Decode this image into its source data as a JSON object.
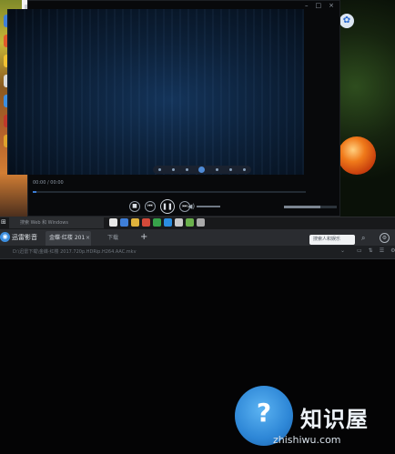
{
  "desktop": {
    "icons": [
      "app-icon",
      "app-icon",
      "app-icon",
      "app-icon",
      "app-icon",
      "app-icon",
      "app-icon",
      "app-icon"
    ]
  },
  "player": {
    "titlebar_buttons": [
      "–",
      "□",
      "×"
    ],
    "time": "00:00 / 00:00",
    "controls": {
      "stop": "■",
      "prev": "⏮",
      "pause": "❚❚",
      "next": "⏭"
    },
    "volume_icon": "◀)",
    "colors": {
      "accent": "#3a7bd5",
      "video_bg": "#0c2038"
    }
  },
  "taskbar": {
    "start": "⊞",
    "search_placeholder": "搜索 Web 和 Windows",
    "apps": [
      "#e7e7e7",
      "#3f7fd8",
      "#e0b23c",
      "#d44a3a",
      "#37a34a",
      "#2b8de0",
      "#c9c9c9",
      "#6ab04c",
      "#a9a9a9"
    ]
  },
  "browser": {
    "name": "迅雷影音",
    "active_tab": "金蝶·红楼 201",
    "tab_close": "×",
    "second_tab": "下载",
    "new_tab": "+",
    "search_placeholder": "搜索人和娱乐",
    "address": "D:\\迅雷下载\\金蝶·红楼 2017.720p.HDRip.H264.AAC.mkv",
    "address_icons": [
      "▭",
      "⇅",
      "☰",
      "⚙"
    ]
  },
  "watermark": {
    "badge_glyph": "?",
    "text": "知识屋",
    "url": "zhishiwu.com"
  }
}
